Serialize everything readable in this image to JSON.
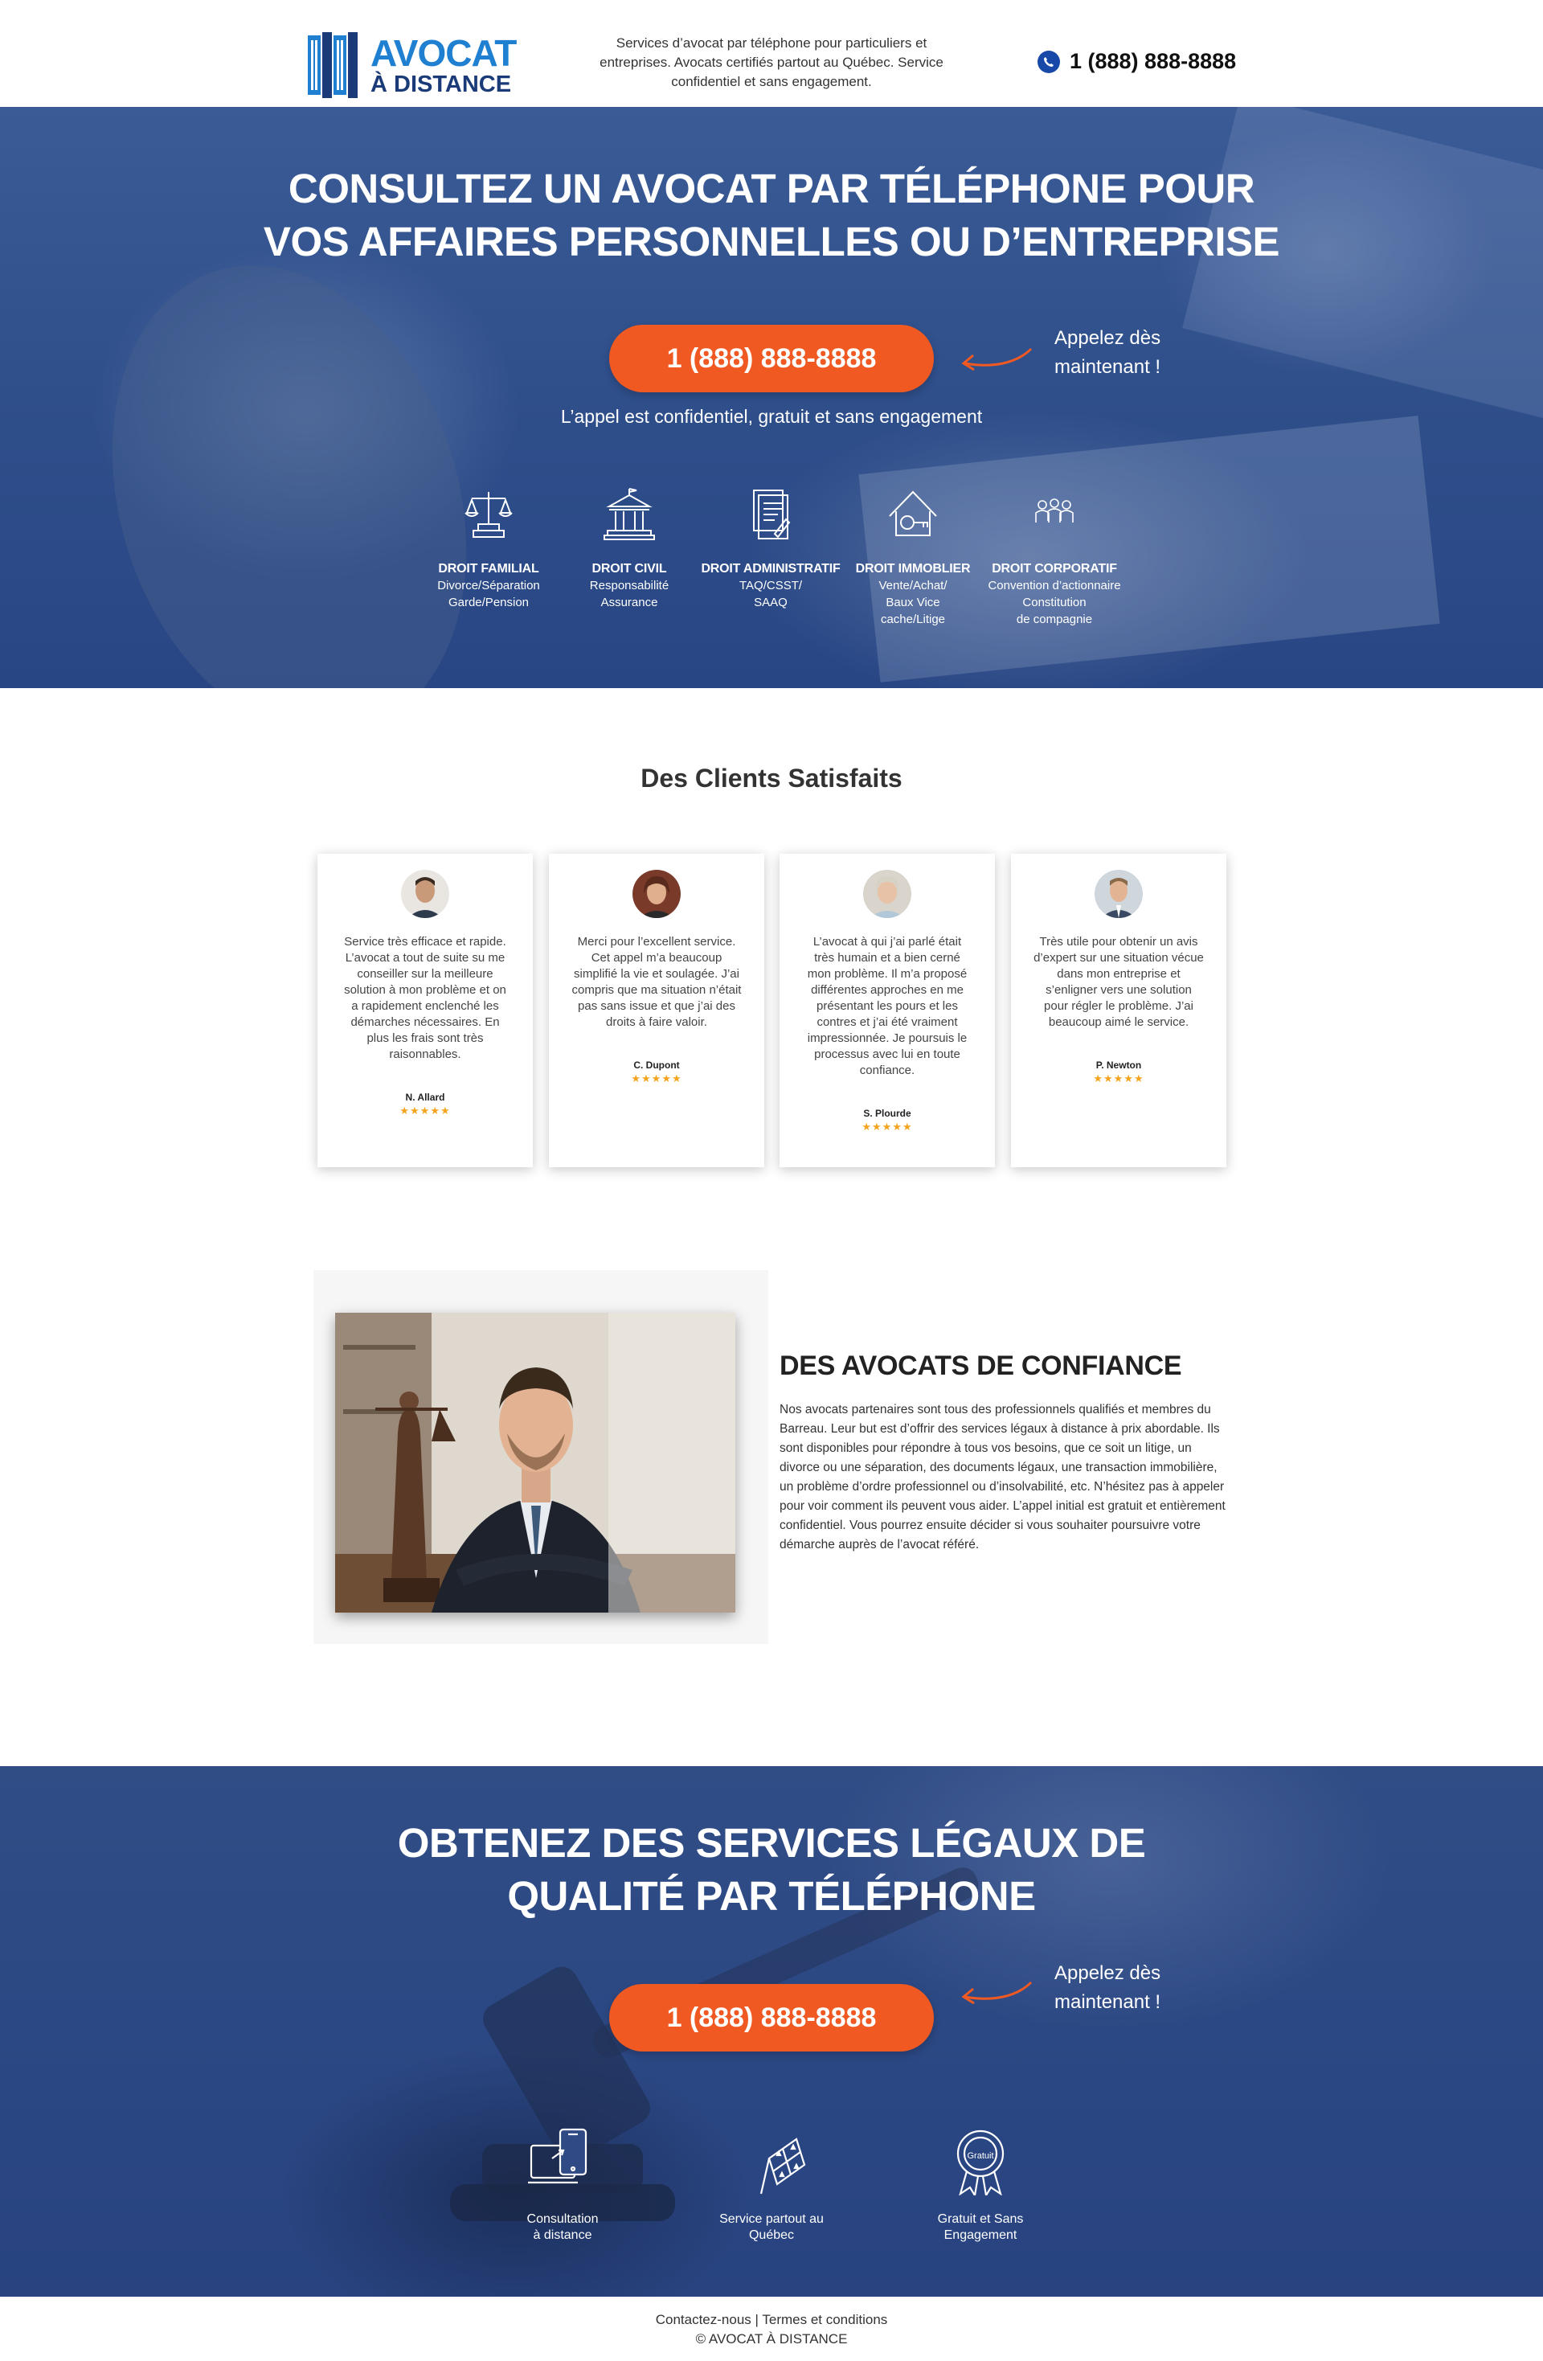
{
  "header": {
    "logo_line1": "AVOCAT",
    "logo_line2": "À DISTANCE",
    "tagline": "Services d’avocat par téléphone pour particuliers et entreprises. Avocats certifiés partout au Québec. Service confidentiel et sans engagement.",
    "phone": "1 (888) 888-8888"
  },
  "hero": {
    "title_line1": "CONSULTEZ UN AVOCAT PAR TÉLÉPHONE POUR",
    "title_line2": "VOS AFFAIRES PERSONNELLES OU D’ENTREPRISE",
    "cta_label": "1 (888) 888-8888",
    "call_now_line1": "Appelez dès",
    "call_now_line2": "maintenant !",
    "subtitle": "L’appel est confidentiel, gratuit et sans engagement",
    "services": [
      {
        "title": "DROIT FAMILIAL",
        "line1": "Divorce/Séparation",
        "line2": "Garde/Pension",
        "line3": "",
        "icon": "scales-icon"
      },
      {
        "title": "DROIT CIVIL",
        "line1": "Responsabilité",
        "line2": "Assurance",
        "line3": "",
        "icon": "courthouse-icon"
      },
      {
        "title": "DROIT ADMINISTRATIF",
        "line1": "TAQ/CSST/",
        "line2": "SAAQ",
        "line3": "",
        "icon": "document-icon"
      },
      {
        "title": "DROIT IMMOBLIER",
        "line1": "Vente/Achat/",
        "line2": "Baux Vice",
        "line3": "cache/Litige",
        "icon": "house-key-icon"
      },
      {
        "title": "DROIT CORPORATIF",
        "line1": "Convention d’actionnaire",
        "line2": "Constitution",
        "line3": "de compagnie",
        "icon": "team-icon"
      }
    ]
  },
  "testimonials": {
    "title": "Des Clients Satisfaits",
    "items": [
      {
        "quote": "Service très efficace et rapide. L’avocat a tout de suite su me conseiller sur la meilleure solution à mon problème et on a rapidement enclenché les démarches nécessaires. En plus les frais sont très raisonnables.",
        "name": "N. Allard",
        "stars": "★★★★★"
      },
      {
        "quote": "Merci pour l’excellent service. Cet appel m’a beaucoup simplifié la vie et soulagée. J’ai compris que ma situation n’était pas sans issue et que j’ai des droits à faire valoir.",
        "name": "C. Dupont",
        "stars": "★★★★★"
      },
      {
        "quote": "L’avocat à qui j’ai parlé était très humain et a bien cerné mon problème. Il m’a proposé différentes approches en me présentant les pours et les contres et j’ai été vraiment impressionnée. Je poursuis le processus avec lui en toute confiance.",
        "name": "S. Plourde",
        "stars": "★★★★★"
      },
      {
        "quote": "Très utile pour obtenir un avis d’expert sur une situation vécue dans mon entreprise et s’enligner vers une solution pour régler le problème. J’ai beaucoup aimé le service.",
        "name": "P. Newton",
        "stars": "★★★★★"
      }
    ]
  },
  "about": {
    "title": "DES AVOCATS DE CONFIANCE",
    "body": "Nos avocats partenaires sont tous des professionnels qualifiés et membres du Barreau. Leur but est d’offrir des services légaux à distance à prix abordable. Ils sont disponibles pour répondre à tous vos besoins, que ce soit un litige, un divorce ou une séparation, des documents légaux, une transaction immobilière, un problème d’ordre professionnel ou d’insolvabilité, etc. N’hésitez pas à appeler pour voir comment ils peuvent vous aider. L’appel initial est gratuit et entièrement confidentiel. Vous pourrez ensuite décider si vous souhaiter poursuivre votre démarche auprès de l’avocat référé."
  },
  "cta2": {
    "title_line1": "OBTENEZ DES SERVICES LÉGAUX DE",
    "title_line2": "QUALITÉ PAR TÉLÉPHONE",
    "cta_label": "1 (888) 888-8888",
    "call_now_line1": "Appelez dès",
    "call_now_line2": "maintenant !",
    "features": [
      {
        "line1": "Consultation",
        "line2": "à distance",
        "icon": "devices-icon"
      },
      {
        "line1": "Service partout au",
        "line2": "Québec",
        "icon": "quebec-flag-icon"
      },
      {
        "line1": "Gratuit et Sans",
        "line2": "Engagement",
        "icon": "free-badge-icon"
      }
    ],
    "badge_text": "Gratuit"
  },
  "footer": {
    "contact": "Contactez-nous",
    "separator": "|",
    "terms": "Termes et conditions",
    "copyright": "©  AVOCAT À DISTANCE"
  },
  "colors": {
    "accent": "#f05a22",
    "brand_blue": "#1f7fd0",
    "navy": "#1a3a78",
    "hero_blue": "#2f4f8b",
    "stars": "#f4a31c"
  }
}
